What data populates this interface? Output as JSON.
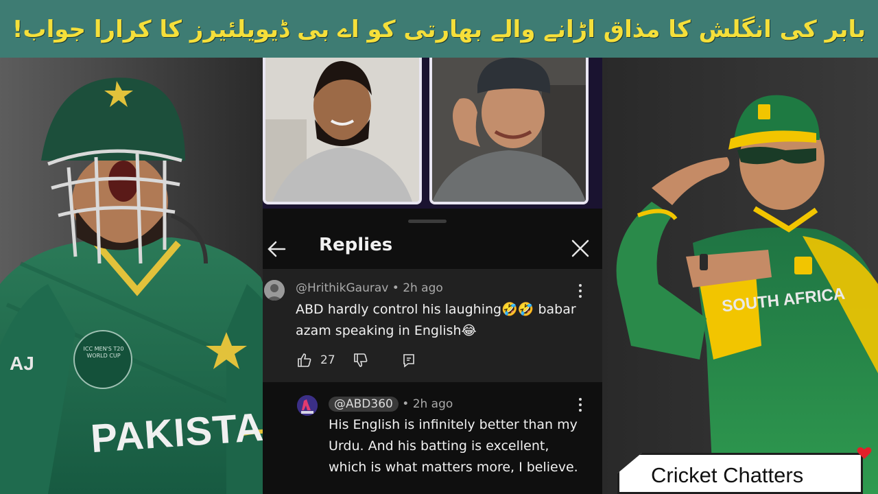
{
  "banner": {
    "headline": "بابر کی انگلش کا مذاق اڑانے والے بھارتی کو اے بی ڈیویلئیرز کا کرارا جواب!"
  },
  "left_player": {
    "jersey_text": "PAKISTAN",
    "badge_text": "ICC MEN'S T20 WORLD CUP",
    "sponsor_text": "AJ"
  },
  "right_player": {
    "jersey_text": "SOUTH AFRICA"
  },
  "video_call": {
    "participants": 2
  },
  "replies_panel": {
    "title": "Replies",
    "comments": [
      {
        "author": "@HrithikGaurav",
        "time": "2h ago",
        "body": "ABD hardly control his laughing🤣🤣 babar azam speaking in English😂",
        "likes": "27"
      },
      {
        "author": "@ABD360",
        "time": "2h ago",
        "body": "His English is infinitely better than my Urdu. And his batting is excellent, which is what matters more, I believe."
      }
    ],
    "icons": [
      "back-arrow-icon",
      "close-icon",
      "more-vert-icon",
      "thumb-up-icon",
      "thumb-down-icon",
      "reply-icon"
    ]
  },
  "brand": {
    "label": "Cricket Chatters"
  },
  "colors": {
    "banner_bg": "#3e7c73",
    "banner_text": "#f5df3a",
    "panel_bg": "#0f0f0f",
    "comment_highlight": "#212121",
    "pakistan_green": "#1f6b4e",
    "sa_green": "#1c6a3c",
    "sa_yellow": "#f2c500"
  }
}
